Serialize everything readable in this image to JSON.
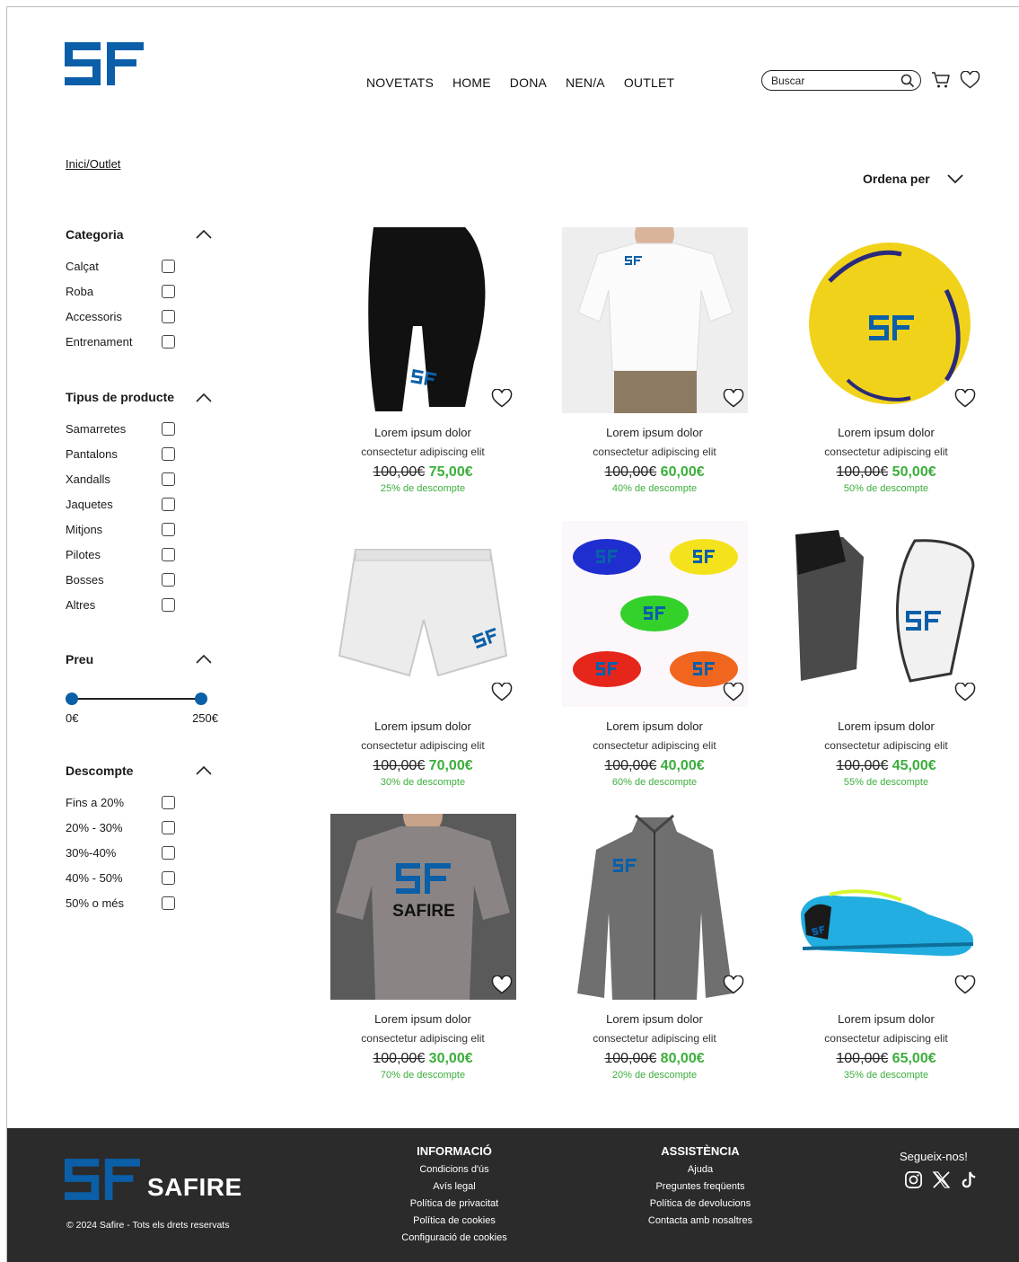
{
  "brand": {
    "name": "SAFIRE",
    "accent": "#0b5fa8",
    "discount_color": "#3cae3c"
  },
  "header": {
    "nav": [
      "NOVETATS",
      "HOME",
      "DONA",
      "NEN/A",
      "OUTLET"
    ],
    "search_placeholder": "Buscar",
    "icons": [
      "search-icon",
      "cart-icon",
      "heart-icon"
    ]
  },
  "breadcrumb": "Inici/Outlet",
  "sort_label": "Ordena per",
  "filters": {
    "categoria": {
      "title": "Categoria",
      "options": [
        "Calçat",
        "Roba",
        "Accessoris",
        "Entrenament"
      ]
    },
    "tipus": {
      "title": "Tipus de producte",
      "options": [
        "Samarretes",
        "Pantalons",
        "Xandalls",
        "Jaquetes",
        "Mitjons",
        "Pilotes",
        "Bosses",
        "Altres"
      ]
    },
    "preu": {
      "title": "Preu",
      "min_label": "0€",
      "max_label": "250€",
      "range": [
        0,
        250
      ]
    },
    "descompte": {
      "title": "Descompte",
      "options": [
        "Fins a 20%",
        "20% - 30%",
        "30%-40%",
        "40% - 50%",
        "50% o més"
      ]
    }
  },
  "products": [
    {
      "name": "Lorem ipsum dolor",
      "desc": "consectetur adipiscing elit",
      "old_price": "100,00€",
      "price": "75,00€",
      "discount": "25% de descompte"
    },
    {
      "name": "Lorem ipsum dolor",
      "desc": "consectetur adipiscing elit",
      "old_price": "100,00€",
      "price": "60,00€",
      "discount": "40% de descompte"
    },
    {
      "name": "Lorem ipsum dolor",
      "desc": "consectetur adipiscing elit",
      "old_price": "100,00€",
      "price": "50,00€",
      "discount": "50% de descompte"
    },
    {
      "name": "Lorem ipsum dolor",
      "desc": "consectetur adipiscing elit",
      "old_price": "100,00€",
      "price": "70,00€",
      "discount": "30% de descompte"
    },
    {
      "name": "Lorem ipsum dolor",
      "desc": "consectetur adipiscing elit",
      "old_price": "100,00€",
      "price": "40,00€",
      "discount": "60% de descompte"
    },
    {
      "name": "Lorem ipsum dolor",
      "desc": "consectetur adipiscing elit",
      "old_price": "100,00€",
      "price": "45,00€",
      "discount": "55% de descompte"
    },
    {
      "name": "Lorem ipsum dolor",
      "desc": "consectetur adipiscing elit",
      "old_price": "100,00€",
      "price": "30,00€",
      "discount": "70% de descompte",
      "image_text": "SAFIRE"
    },
    {
      "name": "Lorem ipsum dolor",
      "desc": "consectetur adipiscing elit",
      "old_price": "100,00€",
      "price": "80,00€",
      "discount": "20% de descompte"
    },
    {
      "name": "Lorem ipsum dolor",
      "desc": "consectetur adipiscing elit",
      "old_price": "100,00€",
      "price": "65,00€",
      "discount": "35% de descompte"
    }
  ],
  "footer": {
    "brand": "SAFIRE",
    "copyright": "© 2024 Safire - Tots els drets reservats",
    "info": {
      "title": "INFORMACIÓ",
      "links": [
        "Condicions d'ús",
        "Avís legal",
        "Política de privacitat",
        "Política de cookies",
        "Configuració de cookies"
      ]
    },
    "assist": {
      "title": "ASSISTÈNCIA",
      "links": [
        "Ajuda",
        "Preguntes freqüents",
        "Política de devolucions",
        "Contacta amb nosaltres"
      ]
    },
    "social_label": "Segueix-nos!",
    "social_icons": [
      "instagram-icon",
      "x-icon",
      "tiktok-icon"
    ]
  }
}
